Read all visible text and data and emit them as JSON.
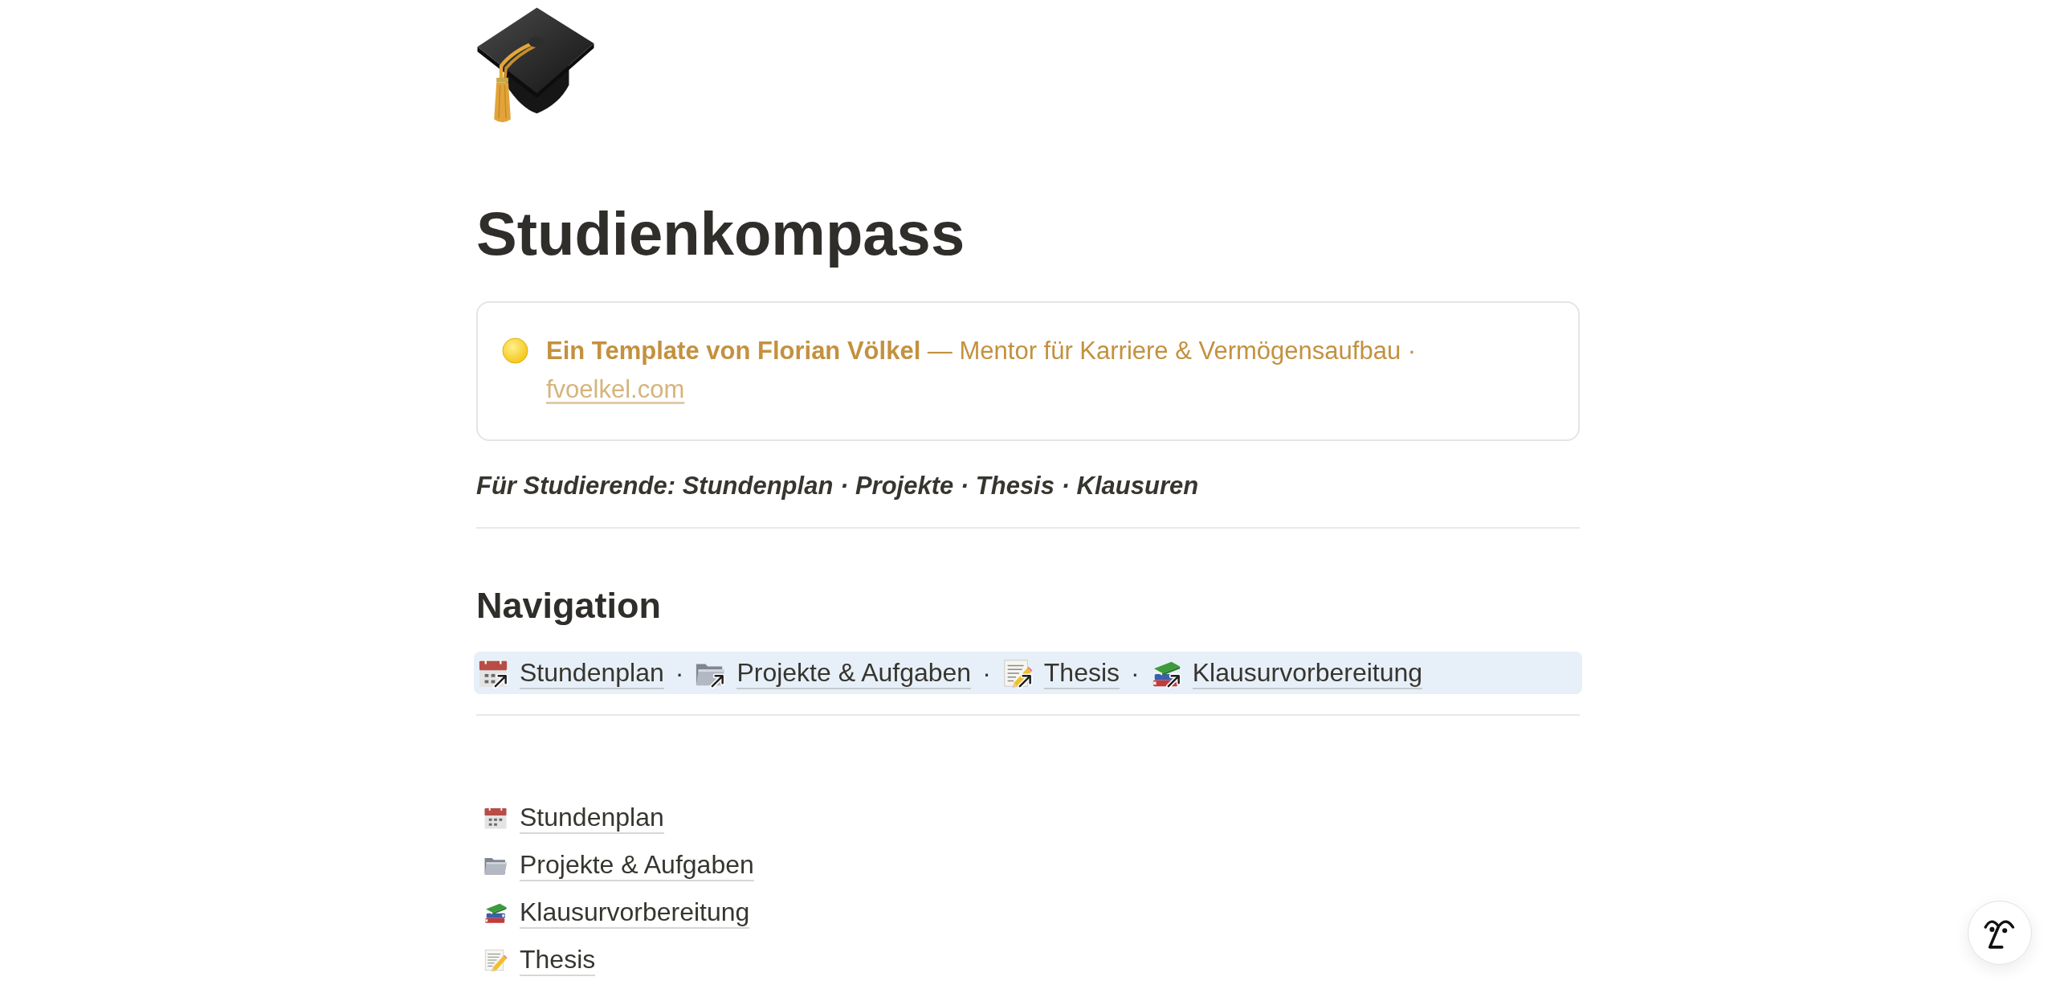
{
  "page": {
    "title": "Studienkompass"
  },
  "callout": {
    "text": "**Ein Template von Florian Völkel** — Mentor für Karriere & Vermögensaufbau ·",
    "link": "fvoelkel.com"
  },
  "subtitle": "Für Studierende: Stundenplan · Projekte · Thesis · Klausuren",
  "navigation": {
    "heading": "Navigation",
    "items": [
      {
        "kind": "link",
        "label": "Stundenplan"
      },
      {
        "kind": "separator",
        "text": "·"
      },
      {
        "kind": "link",
        "label": "Projekte & Aufgaben"
      },
      {
        "kind": "separator",
        "text": "·"
      },
      {
        "kind": "link",
        "label": "Thesis"
      },
      {
        "kind": "separator",
        "text": "·"
      },
      {
        "kind": "link",
        "label": "Klausurvorbereitung"
      }
    ]
  },
  "pages": [
    {
      "label": "Stundenplan"
    },
    {
      "label": "Projekte & Aufgaben"
    },
    {
      "label": "Klausurvorbereitung"
    },
    {
      "label": "Thesis"
    }
  ]
}
